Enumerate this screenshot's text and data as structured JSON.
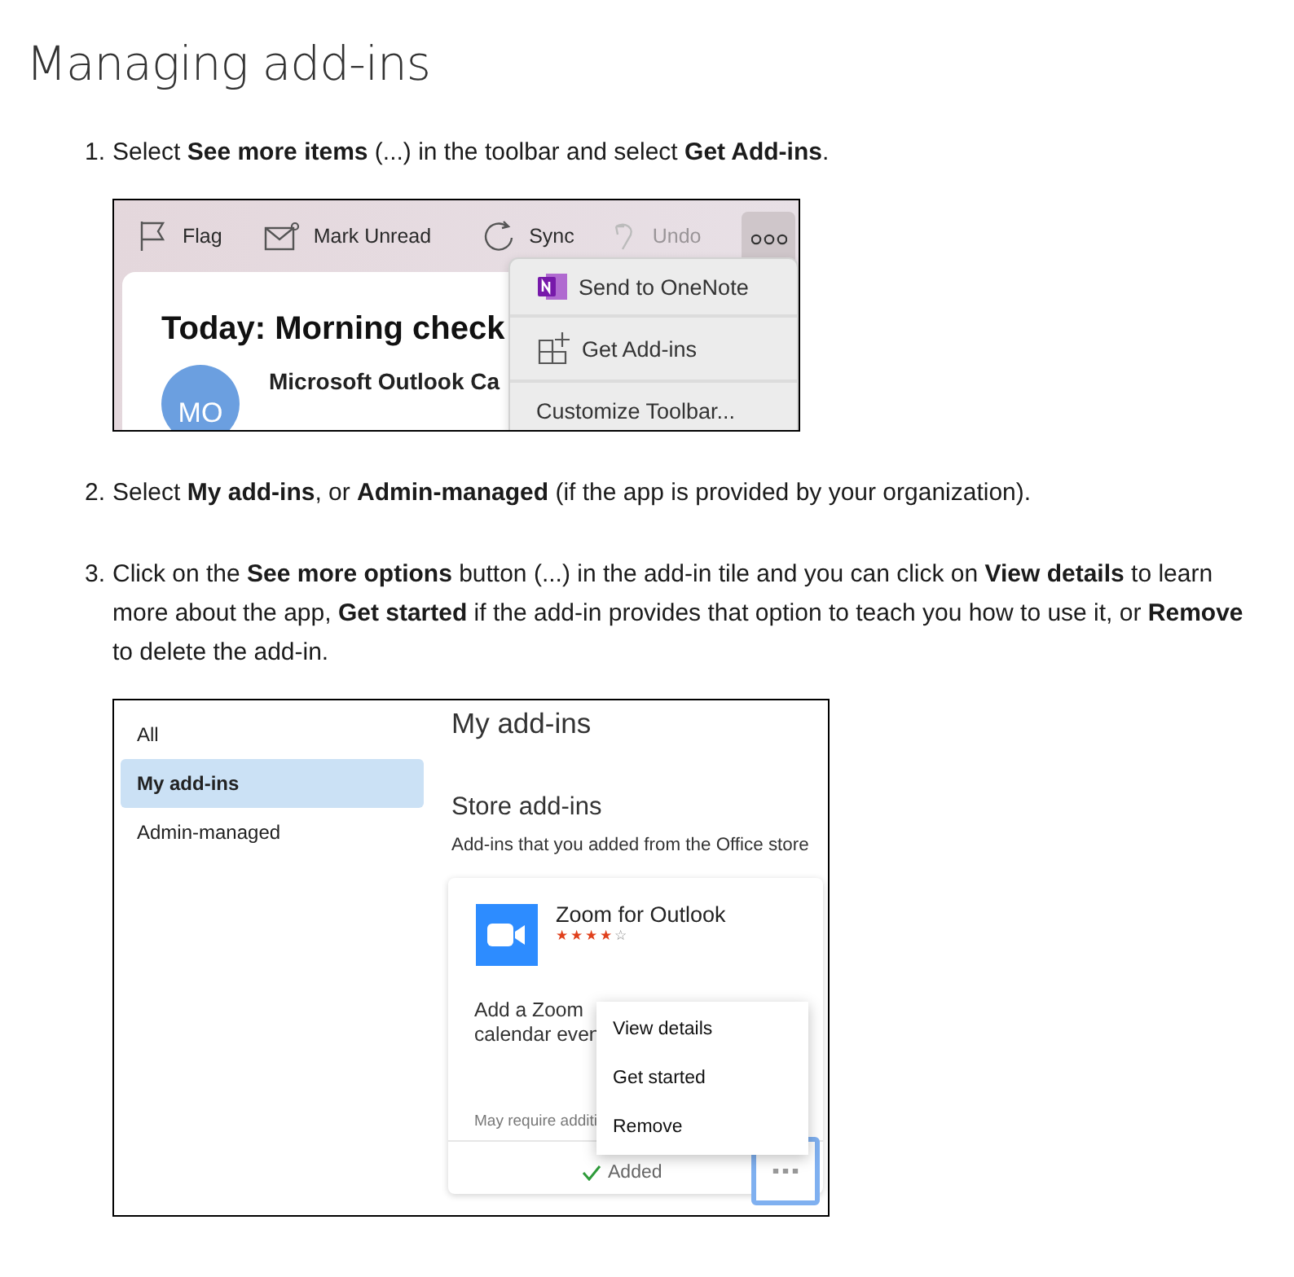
{
  "title": "Managing add-ins",
  "steps": [
    {
      "number": "1.",
      "text": "Select **See more items** (...) in the toolbar and select **Get Add-ins**.",
      "figure": {
        "kind": "toolbar",
        "toolbar": [
          {
            "label": "Flag",
            "disabled": false
          },
          {
            "label": "Mark Unread",
            "disabled": false
          },
          {
            "label": "Sync",
            "disabled": false
          },
          {
            "label": "Undo",
            "disabled": true
          }
        ],
        "more_pressed": true,
        "message": {
          "title": "Today: Morning check",
          "avatar": "MO",
          "sender": "Microsoft Outlook Ca"
        },
        "menu": [
          {
            "label": "Send to OneNote"
          },
          {
            "label": "Get Add-ins"
          },
          {
            "label": "Customize Toolbar..."
          }
        ]
      }
    },
    {
      "number": "2.",
      "text": "Select **My add-ins**, or **Admin-managed** (if the app is provided by your organization)."
    },
    {
      "number": "3.",
      "text": "Click on the **See more options** button (...) in the add-in tile and you can click on **View details** to learn more about the app, **Get started** if the add-in provides that option to teach you how to use it, or **Remove** to delete the add-in.",
      "figure": {
        "kind": "addins",
        "sidebar": [
          {
            "label": "All",
            "selected": false
          },
          {
            "label": "My add-ins",
            "selected": true
          },
          {
            "label": "Admin-managed",
            "selected": false
          }
        ],
        "page_title": "My add-ins",
        "section_title": "Store add-ins",
        "section_subtitle": "Add-ins that you added from the Office store",
        "card": {
          "name": "Zoom for Outlook",
          "stars": 4,
          "description": [
            "Add a Zoom",
            "calendar even"
          ],
          "note": "May require additi",
          "status": "Added"
        },
        "menu": [
          {
            "label": "View details"
          },
          {
            "label": "Get started"
          },
          {
            "label": "Remove"
          }
        ]
      }
    }
  ]
}
